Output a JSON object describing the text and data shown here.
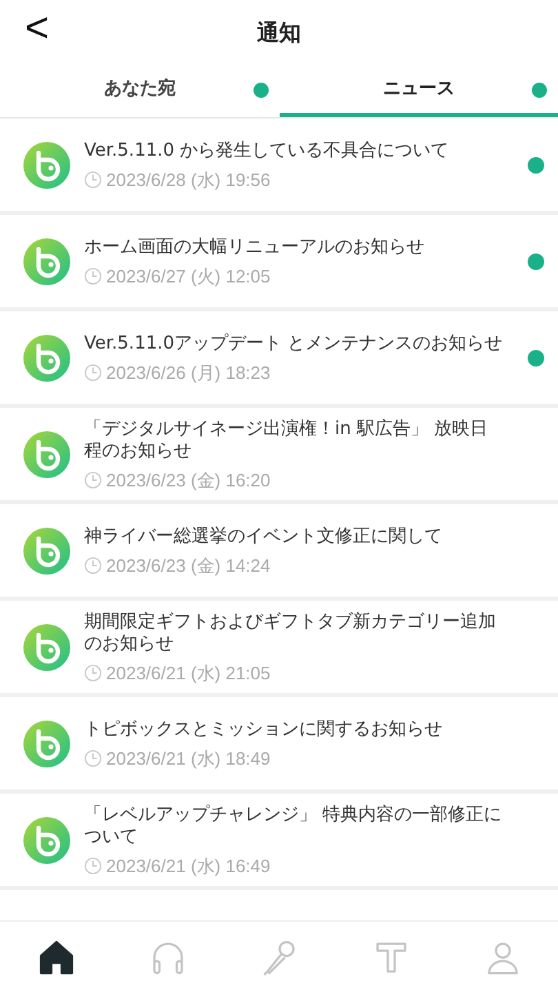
{
  "header": {
    "back": "<",
    "title": "通知"
  },
  "tabs": [
    {
      "label": "あなた宛",
      "selected": false,
      "unread": true
    },
    {
      "label": "ニュース",
      "selected": true,
      "unread": true
    }
  ],
  "news": [
    {
      "title": "Ver.5.11.0 から発生している不具合について",
      "date": "2023/6/28 (水) 19:56",
      "unread": true
    },
    {
      "title": "ホーム画面の大幅リニューアルのお知らせ",
      "date": "2023/6/27 (火) 12:05",
      "unread": true
    },
    {
      "title": "Ver.5.11.0アップデート とメンテナンスのお知らせ",
      "date": "2023/6/26 (月) 18:23",
      "unread": true
    },
    {
      "title": "「デジタルサイネージ出演権！in 駅広告」 放映日程のお知らせ",
      "date": "2023/6/23 (金) 16:20",
      "unread": false
    },
    {
      "title": "神ライバー総選挙のイベント文修正に関して",
      "date": "2023/6/23 (金) 14:24",
      "unread": false
    },
    {
      "title": "期間限定ギフトおよびギフトタブ新カテゴリー追加のお知らせ",
      "date": "2023/6/21 (水) 21:05",
      "unread": false
    },
    {
      "title": "トピボックスとミッションに関するお知らせ",
      "date": "2023/6/21 (水) 18:49",
      "unread": false
    },
    {
      "title": "「レベルアップチャレンジ」 特典内容の一部修正について",
      "date": "2023/6/21 (水) 16:49",
      "unread": false
    }
  ],
  "bottom_nav": [
    {
      "kind": "home",
      "selected": true
    },
    {
      "kind": "headphones",
      "selected": false
    },
    {
      "kind": "microphone",
      "selected": false
    },
    {
      "kind": "ranking",
      "selected": false
    },
    {
      "kind": "profile",
      "selected": false
    }
  ]
}
